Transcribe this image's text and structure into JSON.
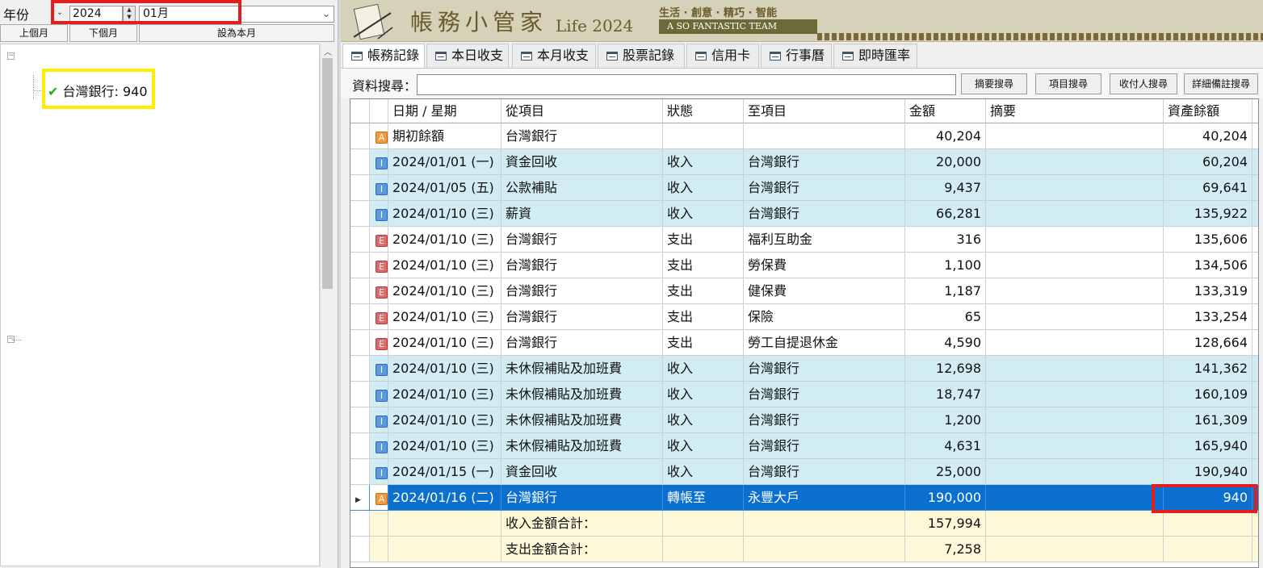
{
  "left": {
    "year_label": "年份",
    "year_value": "2024",
    "month_value": "01月",
    "prev_month": "上個月",
    "next_month": "下個月",
    "set_this_month": "設為本月",
    "tree_node_label": "台灣銀行: 940"
  },
  "banner": {
    "title": "帳務小管家",
    "subtitle": "Life 2024",
    "slogan": "生活 · 創意 · 精巧 · 智能",
    "team": "A SO FANTASTIC TEAM"
  },
  "tabs": [
    {
      "label": "帳務記錄"
    },
    {
      "label": "本日收支"
    },
    {
      "label": "本月收支"
    },
    {
      "label": "股票記錄"
    },
    {
      "label": "信用卡"
    },
    {
      "label": "行事曆"
    },
    {
      "label": "即時匯率"
    }
  ],
  "search": {
    "label": "資料搜尋：",
    "value": "",
    "buttons": [
      "摘要搜尋",
      "項目搜尋",
      "收付人搜尋",
      "詳細備註搜尋"
    ]
  },
  "grid": {
    "headers": [
      "日期 / 星期",
      "從項目",
      "狀態",
      "至項目",
      "金額",
      "摘要",
      "資產餘額"
    ],
    "rows": [
      {
        "type": "A",
        "date": "期初餘額",
        "from": "台灣銀行",
        "status": "",
        "to": "",
        "amount": "40,204",
        "memo": "",
        "balance": "40,204"
      },
      {
        "type": "I",
        "date": "2024/01/01 (一)",
        "from": "資金回收",
        "status": "收入",
        "to": "台灣銀行",
        "amount": "20,000",
        "memo": "",
        "balance": "60,204"
      },
      {
        "type": "I",
        "date": "2024/01/05 (五)",
        "from": "公款補貼",
        "status": "收入",
        "to": "台灣銀行",
        "amount": "9,437",
        "memo": "",
        "balance": "69,641"
      },
      {
        "type": "I",
        "date": "2024/01/10 (三)",
        "from": "薪資",
        "status": "收入",
        "to": "台灣銀行",
        "amount": "66,281",
        "memo": "",
        "balance": "135,922"
      },
      {
        "type": "E",
        "date": "2024/01/10 (三)",
        "from": "台灣銀行",
        "status": "支出",
        "to": "福利互助金",
        "amount": "316",
        "memo": "",
        "balance": "135,606"
      },
      {
        "type": "E",
        "date": "2024/01/10 (三)",
        "from": "台灣銀行",
        "status": "支出",
        "to": "勞保費",
        "amount": "1,100",
        "memo": "",
        "balance": "134,506"
      },
      {
        "type": "E",
        "date": "2024/01/10 (三)",
        "from": "台灣銀行",
        "status": "支出",
        "to": "健保費",
        "amount": "1,187",
        "memo": "",
        "balance": "133,319"
      },
      {
        "type": "E",
        "date": "2024/01/10 (三)",
        "from": "台灣銀行",
        "status": "支出",
        "to": "保險",
        "amount": "65",
        "memo": "",
        "balance": "133,254"
      },
      {
        "type": "E",
        "date": "2024/01/10 (三)",
        "from": "台灣銀行",
        "status": "支出",
        "to": "勞工自提退休金",
        "amount": "4,590",
        "memo": "",
        "balance": "128,664"
      },
      {
        "type": "I",
        "date": "2024/01/10 (三)",
        "from": "未休假補貼及加班費",
        "status": "收入",
        "to": "台灣銀行",
        "amount": "12,698",
        "memo": "",
        "balance": "141,362"
      },
      {
        "type": "I",
        "date": "2024/01/10 (三)",
        "from": "未休假補貼及加班費",
        "status": "收入",
        "to": "台灣銀行",
        "amount": "18,747",
        "memo": "",
        "balance": "160,109"
      },
      {
        "type": "I",
        "date": "2024/01/10 (三)",
        "from": "未休假補貼及加班費",
        "status": "收入",
        "to": "台灣銀行",
        "amount": "1,200",
        "memo": "",
        "balance": "161,309"
      },
      {
        "type": "I",
        "date": "2024/01/10 (三)",
        "from": "未休假補貼及加班費",
        "status": "收入",
        "to": "台灣銀行",
        "amount": "4,631",
        "memo": "",
        "balance": "165,940"
      },
      {
        "type": "I",
        "date": "2024/01/15 (一)",
        "from": "資金回收",
        "status": "收入",
        "to": "台灣銀行",
        "amount": "25,000",
        "memo": "",
        "balance": "190,940"
      },
      {
        "type": "A",
        "date": "2024/01/16 (二)",
        "from": "台灣銀行",
        "status": "轉帳至",
        "to": "永豐大戶",
        "amount": "190,000",
        "memo": "",
        "balance": "940",
        "selected": true
      }
    ],
    "summary": [
      {
        "label": "收入金額合計：",
        "amount": "157,994"
      },
      {
        "label": "支出金額合計：",
        "amount": "7,258"
      }
    ]
  },
  "colors": {
    "highlight_red": "#e02020",
    "highlight_yellow": "#ffee00",
    "selected_row": "#0a6fcf",
    "income_row": "#d2ecf4",
    "summary_row": "#fdf8d8"
  }
}
